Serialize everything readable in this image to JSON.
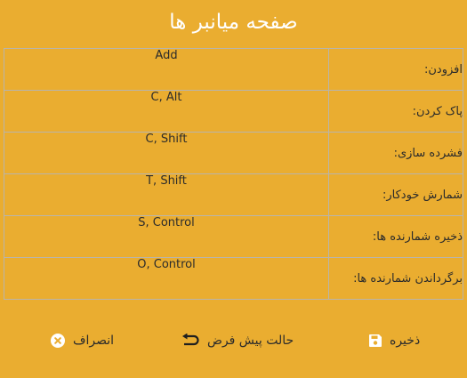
{
  "dialog": {
    "title": "صفحه میانبر ها"
  },
  "shortcuts": [
    {
      "label": "افزودن:",
      "keys": "Add"
    },
    {
      "label": "پاک کردن:",
      "keys": "C, Alt"
    },
    {
      "label": "فشرده سازی:",
      "keys": "C, Shift"
    },
    {
      "label": "شمارش خودکار:",
      "keys": "T, Shift"
    },
    {
      "label": "ذخیره شمارنده ها:",
      "keys": "S, Control"
    },
    {
      "label": "برگرداندن شمارنده ها:",
      "keys": "O, Control"
    }
  ],
  "footer": {
    "cancel_label": "انصراف",
    "cancel_icon": "close-circle-icon",
    "default_label": "حالت پیش فرض",
    "default_icon": "undo-arrow-icon",
    "save_label": "ذخیره",
    "save_icon": "floppy-disk-icon"
  },
  "colors": {
    "background": "#eaad30",
    "title_text": "#ffffff",
    "grid_line": "#b9b4ab",
    "text": "#2b2b2b"
  }
}
